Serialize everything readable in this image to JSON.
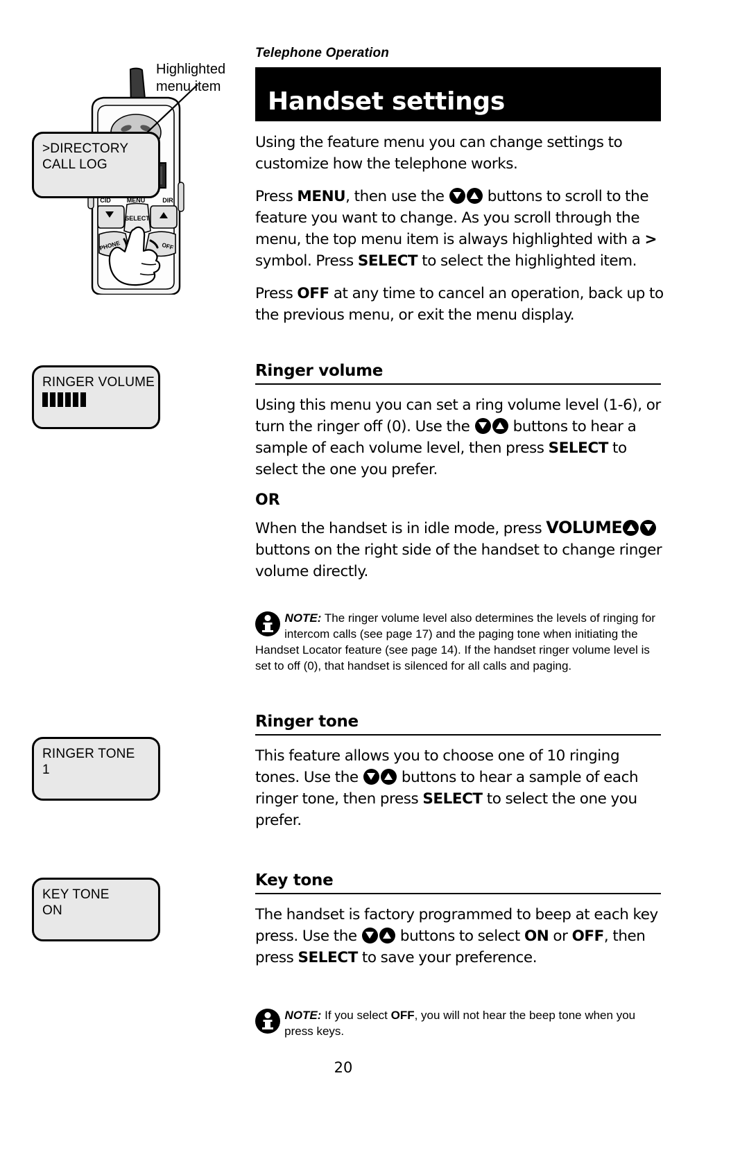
{
  "running_head": "Telephone Operation",
  "title": "Handset settings",
  "callout": {
    "label_line1": "Highlighted",
    "label_line2": "menu item"
  },
  "phone_art": {
    "key_labels": {
      "cid": "CID",
      "menu": "MENU",
      "dir": "DIR",
      "select": "SELECT",
      "phone": "PHONE",
      "off": "OFF"
    }
  },
  "screens": {
    "directory": {
      "line1": ">DIRECTORY",
      "line2": "CALL LOG"
    },
    "ringer_volume": {
      "line1": "RINGER VOLUME",
      "bars": 6
    },
    "ringer_tone": {
      "line1": "RINGER TONE",
      "line2": "1"
    },
    "key_tone": {
      "line1": "KEY TONE",
      "line2": "ON"
    }
  },
  "intro": {
    "p1": "Using the feature menu you can change settings to customize how the telephone works.",
    "p2_a": "Press ",
    "p2_menu": "MENU",
    "p2_b": ", then use the ",
    "p2_c": " buttons to scroll to the feature you want to change.  As you scroll through the menu, the top menu item is always highlighted with a ",
    "p2_gt": ">",
    "p2_d": " symbol. Press ",
    "p2_select": "SELECT",
    "p2_e": " to select the highlighted item.",
    "p3_a": "Press ",
    "p3_off": "OFF",
    "p3_b": " at any time to cancel an operation, back up to the previous menu, or exit the menu display."
  },
  "ringer_volume_section": {
    "heading": "Ringer volume",
    "p1_a": "Using this menu you can set a ring volume level (1-6), or turn the ringer off (0). Use the ",
    "p1_b": " buttons to hear a sample of each volume level, then press ",
    "p1_select": "SELECT",
    "p1_c": " to select the one you prefer.",
    "or": "OR",
    "p2_a": "When the handset is in idle mode, press ",
    "p2_volume": "VOLUME",
    "p2_b": " buttons on the right side of the handset to change ringer volume directly.",
    "note_label": "NOTE:",
    "note_text": " The ringer volume level also determines the levels of ringing for intercom calls (see page 17) and the paging tone when initiating the Handset Locator feature (see page 14). If the handset ringer volume level is set to off (0), that handset is silenced for all calls and paging."
  },
  "ringer_tone_section": {
    "heading": "Ringer tone",
    "p1_a": "This feature allows you to choose one of 10 ringing tones. Use the ",
    "p1_b": " buttons to hear a sample of each ringer tone, then press ",
    "p1_select": "SELECT",
    "p1_c": " to select the one you prefer."
  },
  "key_tone_section": {
    "heading": "Key tone",
    "p1_a": "The handset is factory programmed to beep at each key press. Use the ",
    "p1_b": " buttons to select ",
    "p1_on": "ON",
    "p1_or": " or ",
    "p1_off": "OFF",
    "p1_c": ", then press ",
    "p1_select": "SELECT",
    "p1_d": " to save your preference.",
    "note_label": "NOTE:",
    "note_text": "  If you select ",
    "note_off": "OFF",
    "note_text2": ", you will not hear the beep tone when you press keys."
  },
  "page_number": "20"
}
